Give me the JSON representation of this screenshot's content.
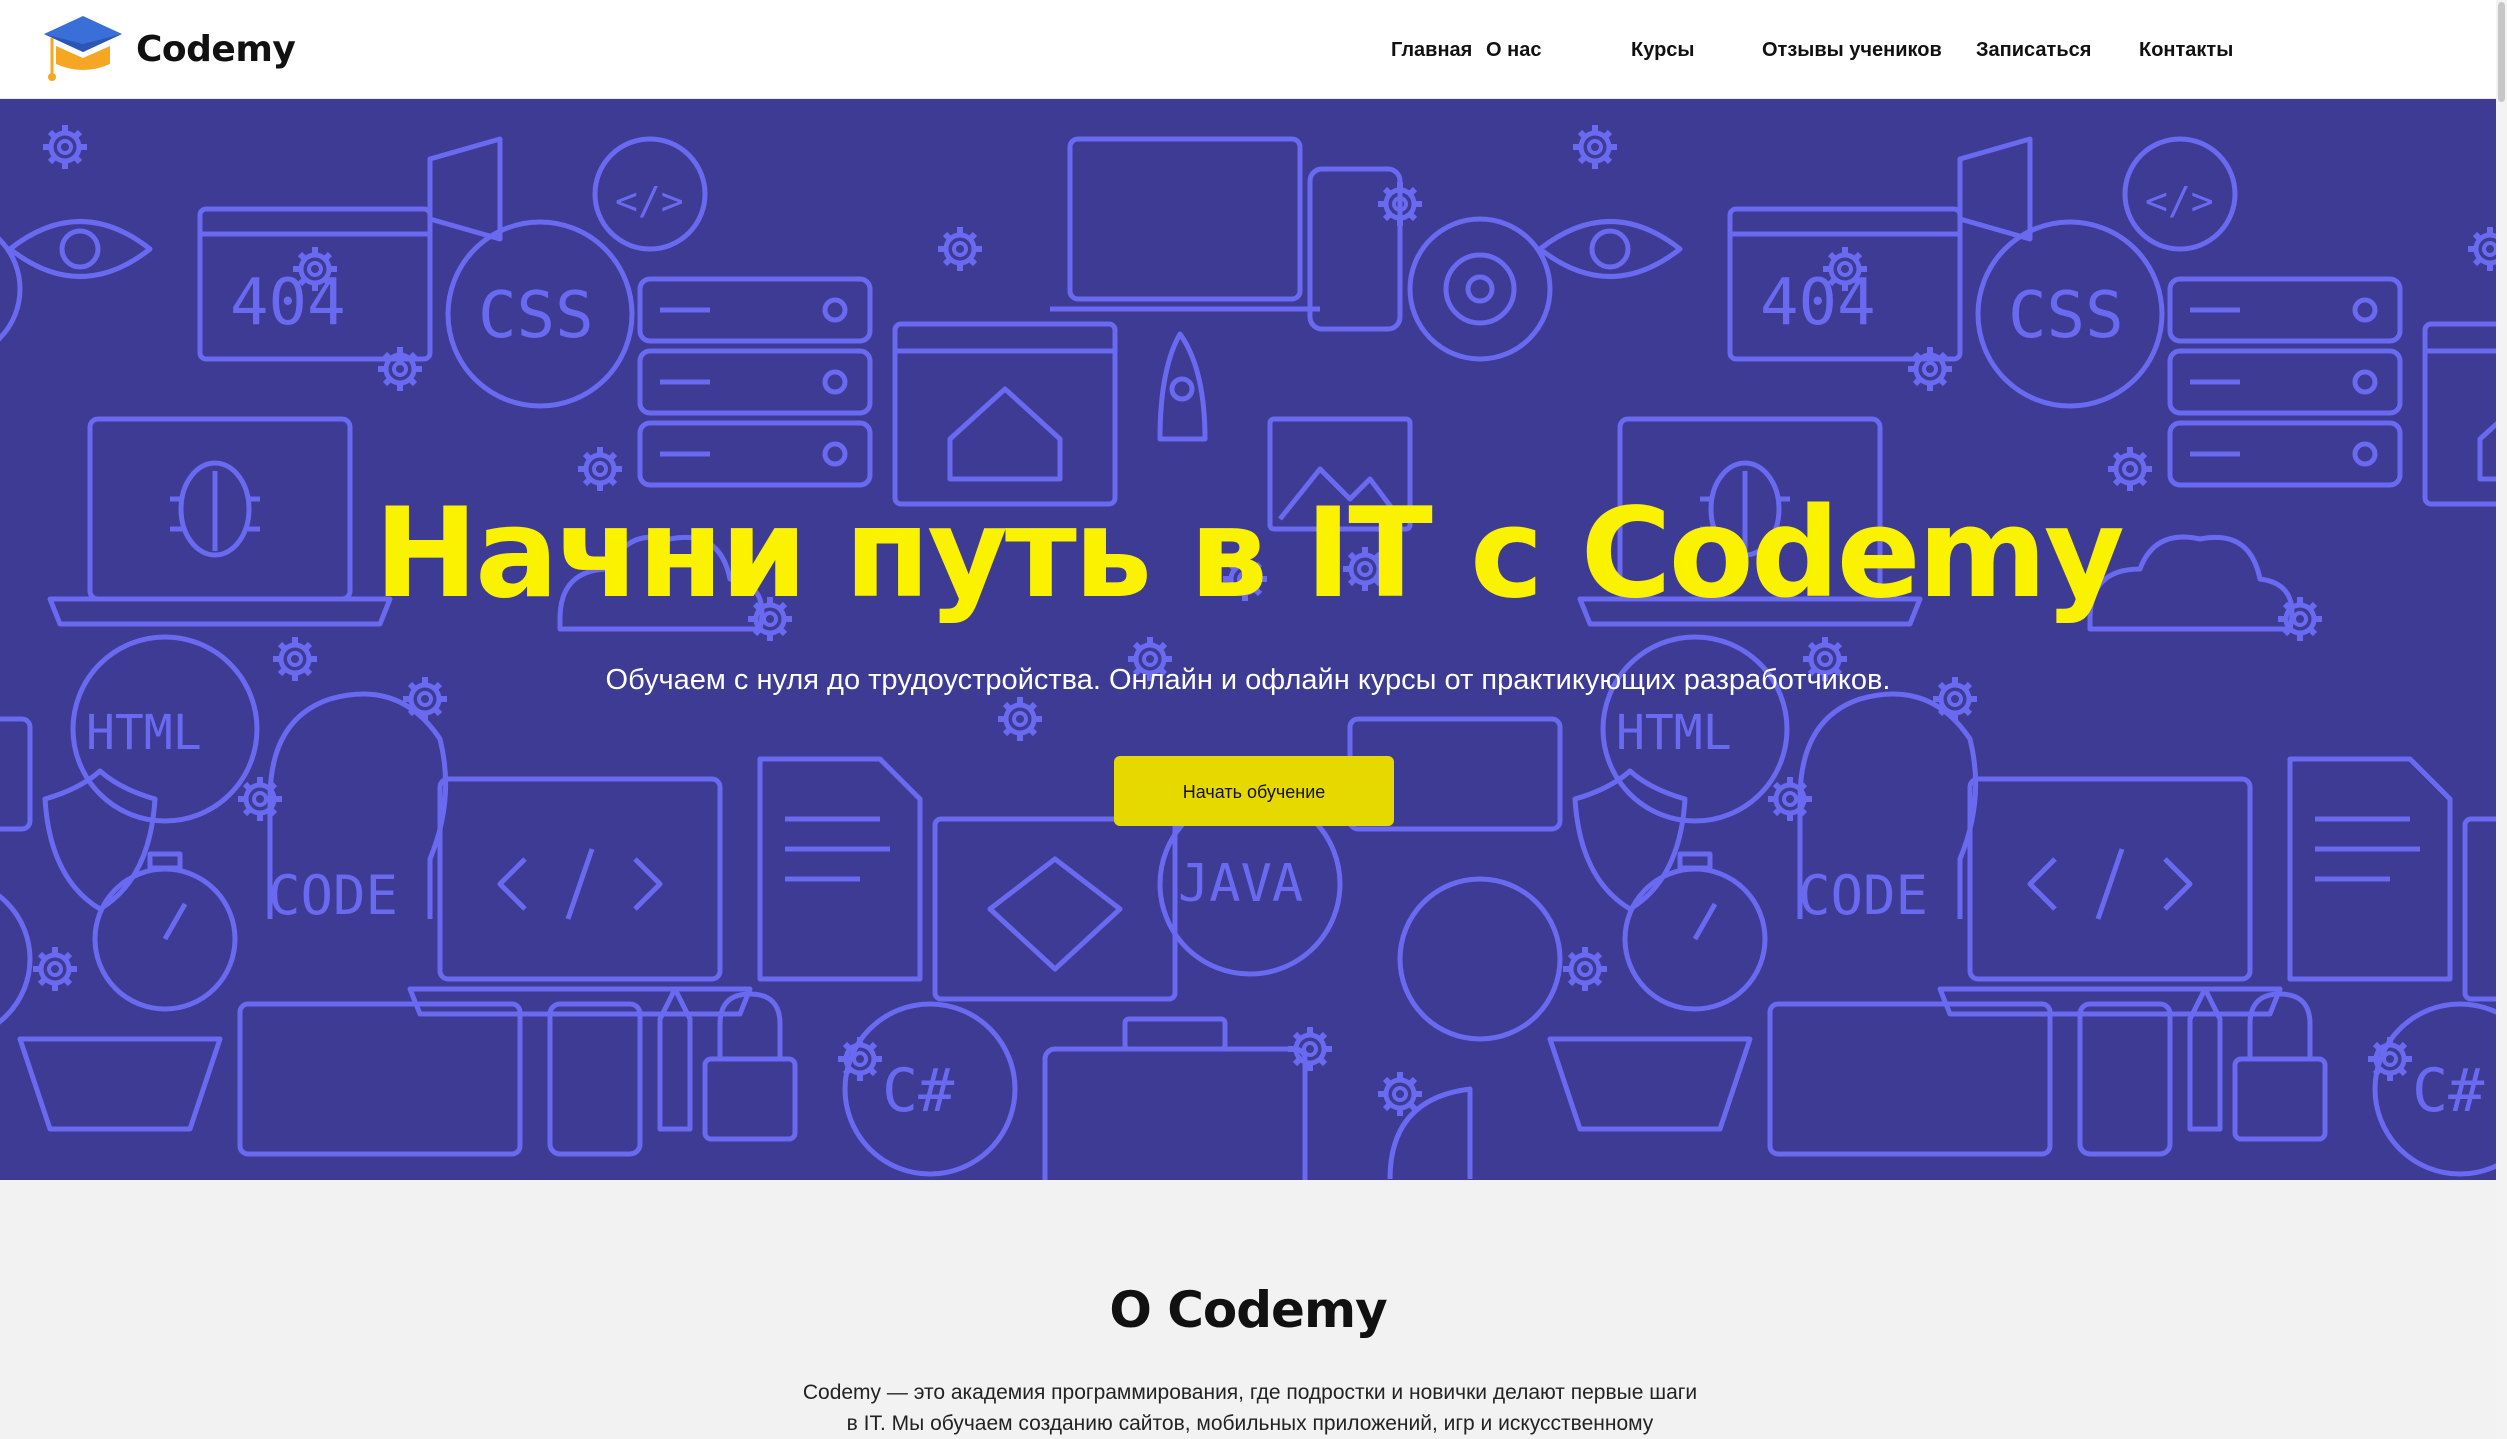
{
  "header": {
    "logo_text": "Codemy",
    "nav": [
      {
        "label": "Главная"
      },
      {
        "label": "О нас"
      },
      {
        "label": "Курсы"
      },
      {
        "label": "Отзывы учеников"
      },
      {
        "label": "Записаться"
      },
      {
        "label": "Контакты"
      }
    ]
  },
  "hero": {
    "title": "Начни путь в IT с Codemy",
    "subtitle": "Обучаем с нуля до трудоустройства. Онлайн и офлайн курсы от практикующих разработчиков.",
    "cta_label": "Начать обучение",
    "pattern_labels": [
      "404",
      "CSS",
      "HTML",
      "CODE",
      "JAVA",
      "C#",
      "</>"
    ]
  },
  "about": {
    "title": "О Codemy",
    "text_line1": "Codemy — это академия программирования, где подростки и новички делают первые шаги",
    "text_line2": "в IT. Мы обучаем созданию сайтов, мобильных приложений, игр и искусственному"
  },
  "colors": {
    "hero_bg": "#3d3b94",
    "hero_pattern": "#6a6af0",
    "title_yellow": "#fbf200",
    "button_yellow": "#e6d900",
    "logo_blue": "#3b6fd8",
    "logo_orange": "#f5a623"
  },
  "icons": [
    "graduation-cap-icon",
    "monitor-icon",
    "gear-icon",
    "bug-icon",
    "rocket-icon",
    "eye-icon",
    "server-icon",
    "megaphone-icon",
    "cloud-icon",
    "shield-icon",
    "stopwatch-icon",
    "keyboard-icon",
    "diamond-icon",
    "home-icon",
    "calculator-icon",
    "lock-icon",
    "briefcase-icon",
    "pencil-icon"
  ]
}
